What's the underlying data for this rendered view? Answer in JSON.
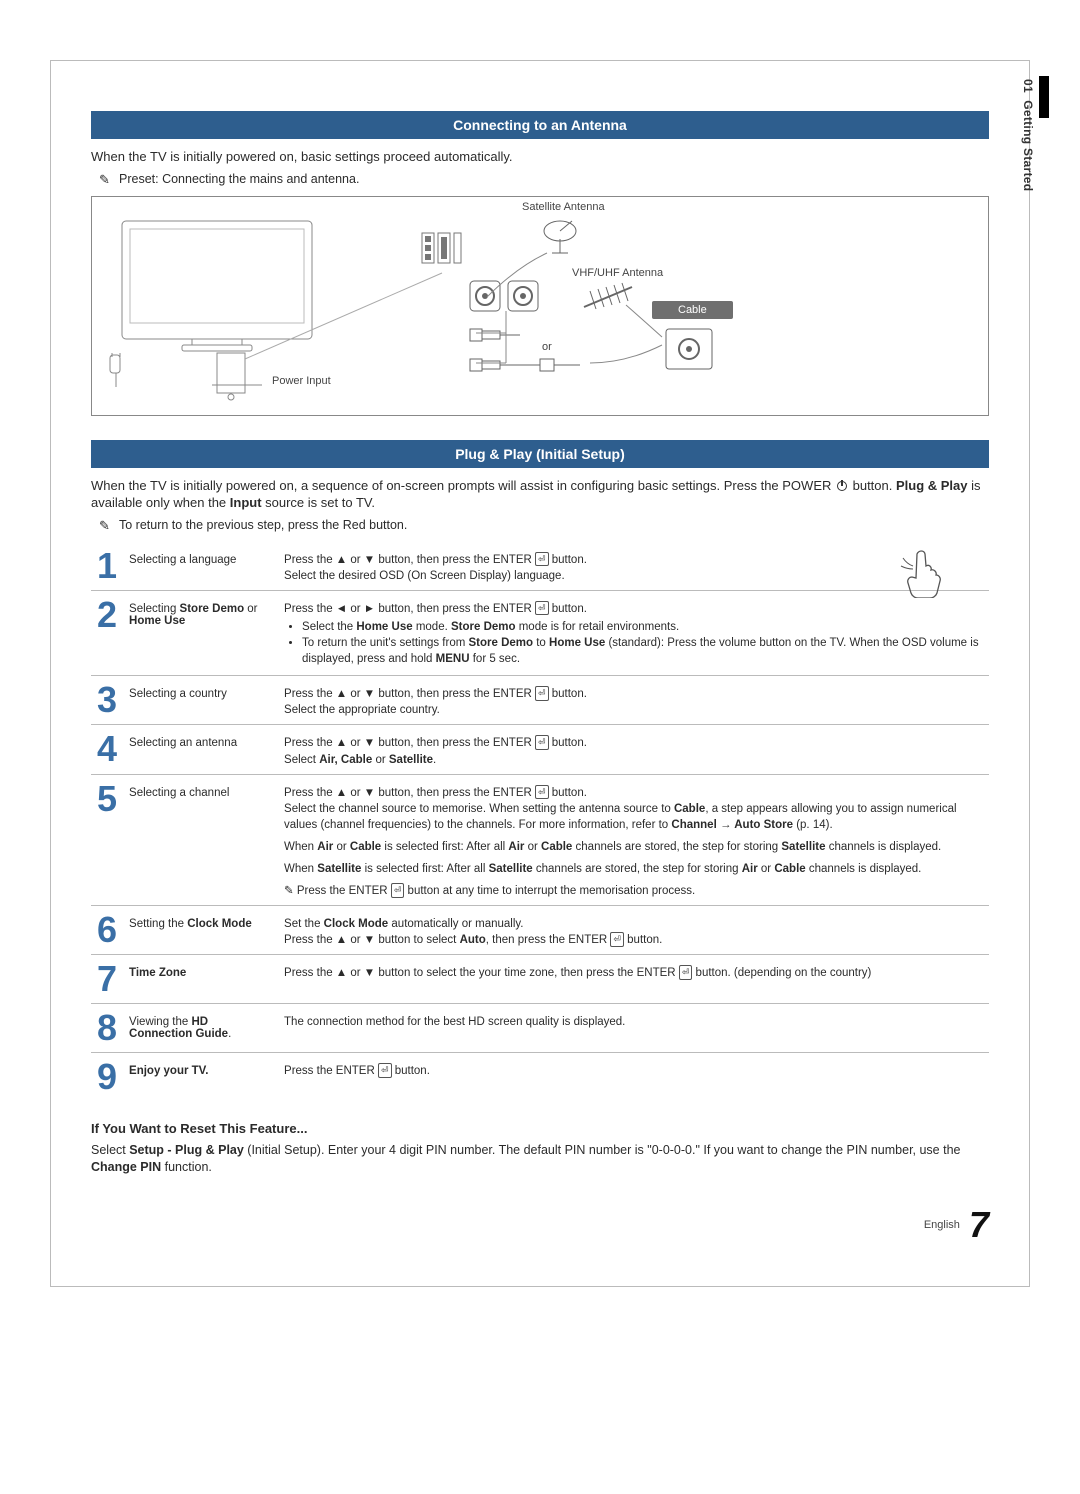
{
  "sidebar": {
    "chapter_num": "01",
    "chapter_title": "Getting Started"
  },
  "section1": {
    "title": "Connecting to an Antenna",
    "intro": "When the TV is initially powered on, basic settings proceed automatically.",
    "preset_note": "Preset: Connecting the mains and antenna.",
    "diagram": {
      "sat_antenna": "Satellite Antenna",
      "vhf_uhf": "VHF/UHF Antenna",
      "power_input": "Power Input",
      "or": "or",
      "cable": "Cable"
    }
  },
  "section2": {
    "title": "Plug & Play (Initial Setup)",
    "intro_html": "When the TV is initially powered on, a sequence of on-screen prompts will assist in configuring basic settings. Press the POWER {PWR} button. <b>Plug & Play</b> is available only when the <b>Input</b> source is set to TV.",
    "return_note": "To return to the previous step, press the Red button.",
    "steps": [
      {
        "num": "1",
        "title_html": "Selecting a language",
        "desc_html": "Press the ▲ or ▼ button, then press the ENTER {ENT} button.<br>Select the desired OSD (On Screen Display) language."
      },
      {
        "num": "2",
        "title_html": "Selecting <b>Store Demo</b> or <b>Home Use</b>",
        "desc_html": "Press the ◄ or ► button, then press the ENTER {ENT} button.<ul><li>Select the <b>Home Use</b> mode. <b>Store Demo</b> mode is for retail environments.</li><li>To return the unit's settings from <b>Store Demo</b> to <b>Home Use</b> (standard): Press the volume button on the TV. When the OSD volume is displayed, press and hold <b>MENU</b> for 5 sec.</li></ul>"
      },
      {
        "num": "3",
        "title_html": "Selecting a country",
        "desc_html": "Press the ▲ or ▼ button, then press the ENTER {ENT} button.<br>Select the appropriate country."
      },
      {
        "num": "4",
        "title_html": "Selecting an antenna",
        "desc_html": "Press the ▲ or ▼ button, then press the ENTER {ENT} button.<br>Select <b>Air, Cable</b> or <b>Satellite</b>."
      },
      {
        "num": "5",
        "title_html": "Selecting a channel",
        "desc_html": "<p>Press the ▲ or ▼ button, then press the ENTER {ENT} button.<br>Select the channel source to memorise. When setting the antenna source to <b>Cable</b>, a step appears allowing you to assign numerical values (channel frequencies) to the channels. For more information, refer to <b>Channel → Auto Store</b> (p. 14).</p><p>When <b>Air</b> or <b>Cable</b> is selected first: After all <b>Air</b> or <b>Cable</b> channels are stored, the step for storing <b>Satellite</b> channels is displayed.</p><p>When <b>Satellite</b> is selected first: After all <b>Satellite</b> channels are stored, the step for storing <b>Air</b> or <b>Cable</b> channels is displayed.</p><p style='margin-bottom:0'>✎ Press the ENTER {ENT} button at any time to interrupt the memorisation process.</p>"
      },
      {
        "num": "6",
        "title_html": "Setting the <b>Clock Mode</b>",
        "desc_html": "Set the <b>Clock Mode</b> automatically or manually.<br>Press the ▲ or ▼ button to select <b>Auto</b>, then press the ENTER {ENT} button."
      },
      {
        "num": "7",
        "title_html": "<b>Time Zone</b>",
        "desc_html": "Press the ▲ or ▼ button to select the your time zone, then press the ENTER {ENT} button. (depending on the country)"
      },
      {
        "num": "8",
        "title_html": "Viewing the <b>HD Connection Guide</b>.",
        "desc_html": "The connection method for the best HD screen quality is displayed."
      },
      {
        "num": "9",
        "title_html": "<b>Enjoy your TV.</b>",
        "desc_html": "Press the ENTER {ENT} button."
      }
    ]
  },
  "reset": {
    "heading": "If You Want to Reset This Feature...",
    "body_html": "Select <b>Setup - Plug & Play</b> (Initial Setup). Enter your 4 digit PIN number. The default PIN number is \"0-0-0-0.\" If you want to change the PIN number, use the <b>Change PIN</b> function."
  },
  "footer": {
    "lang": "English",
    "page": "7"
  }
}
